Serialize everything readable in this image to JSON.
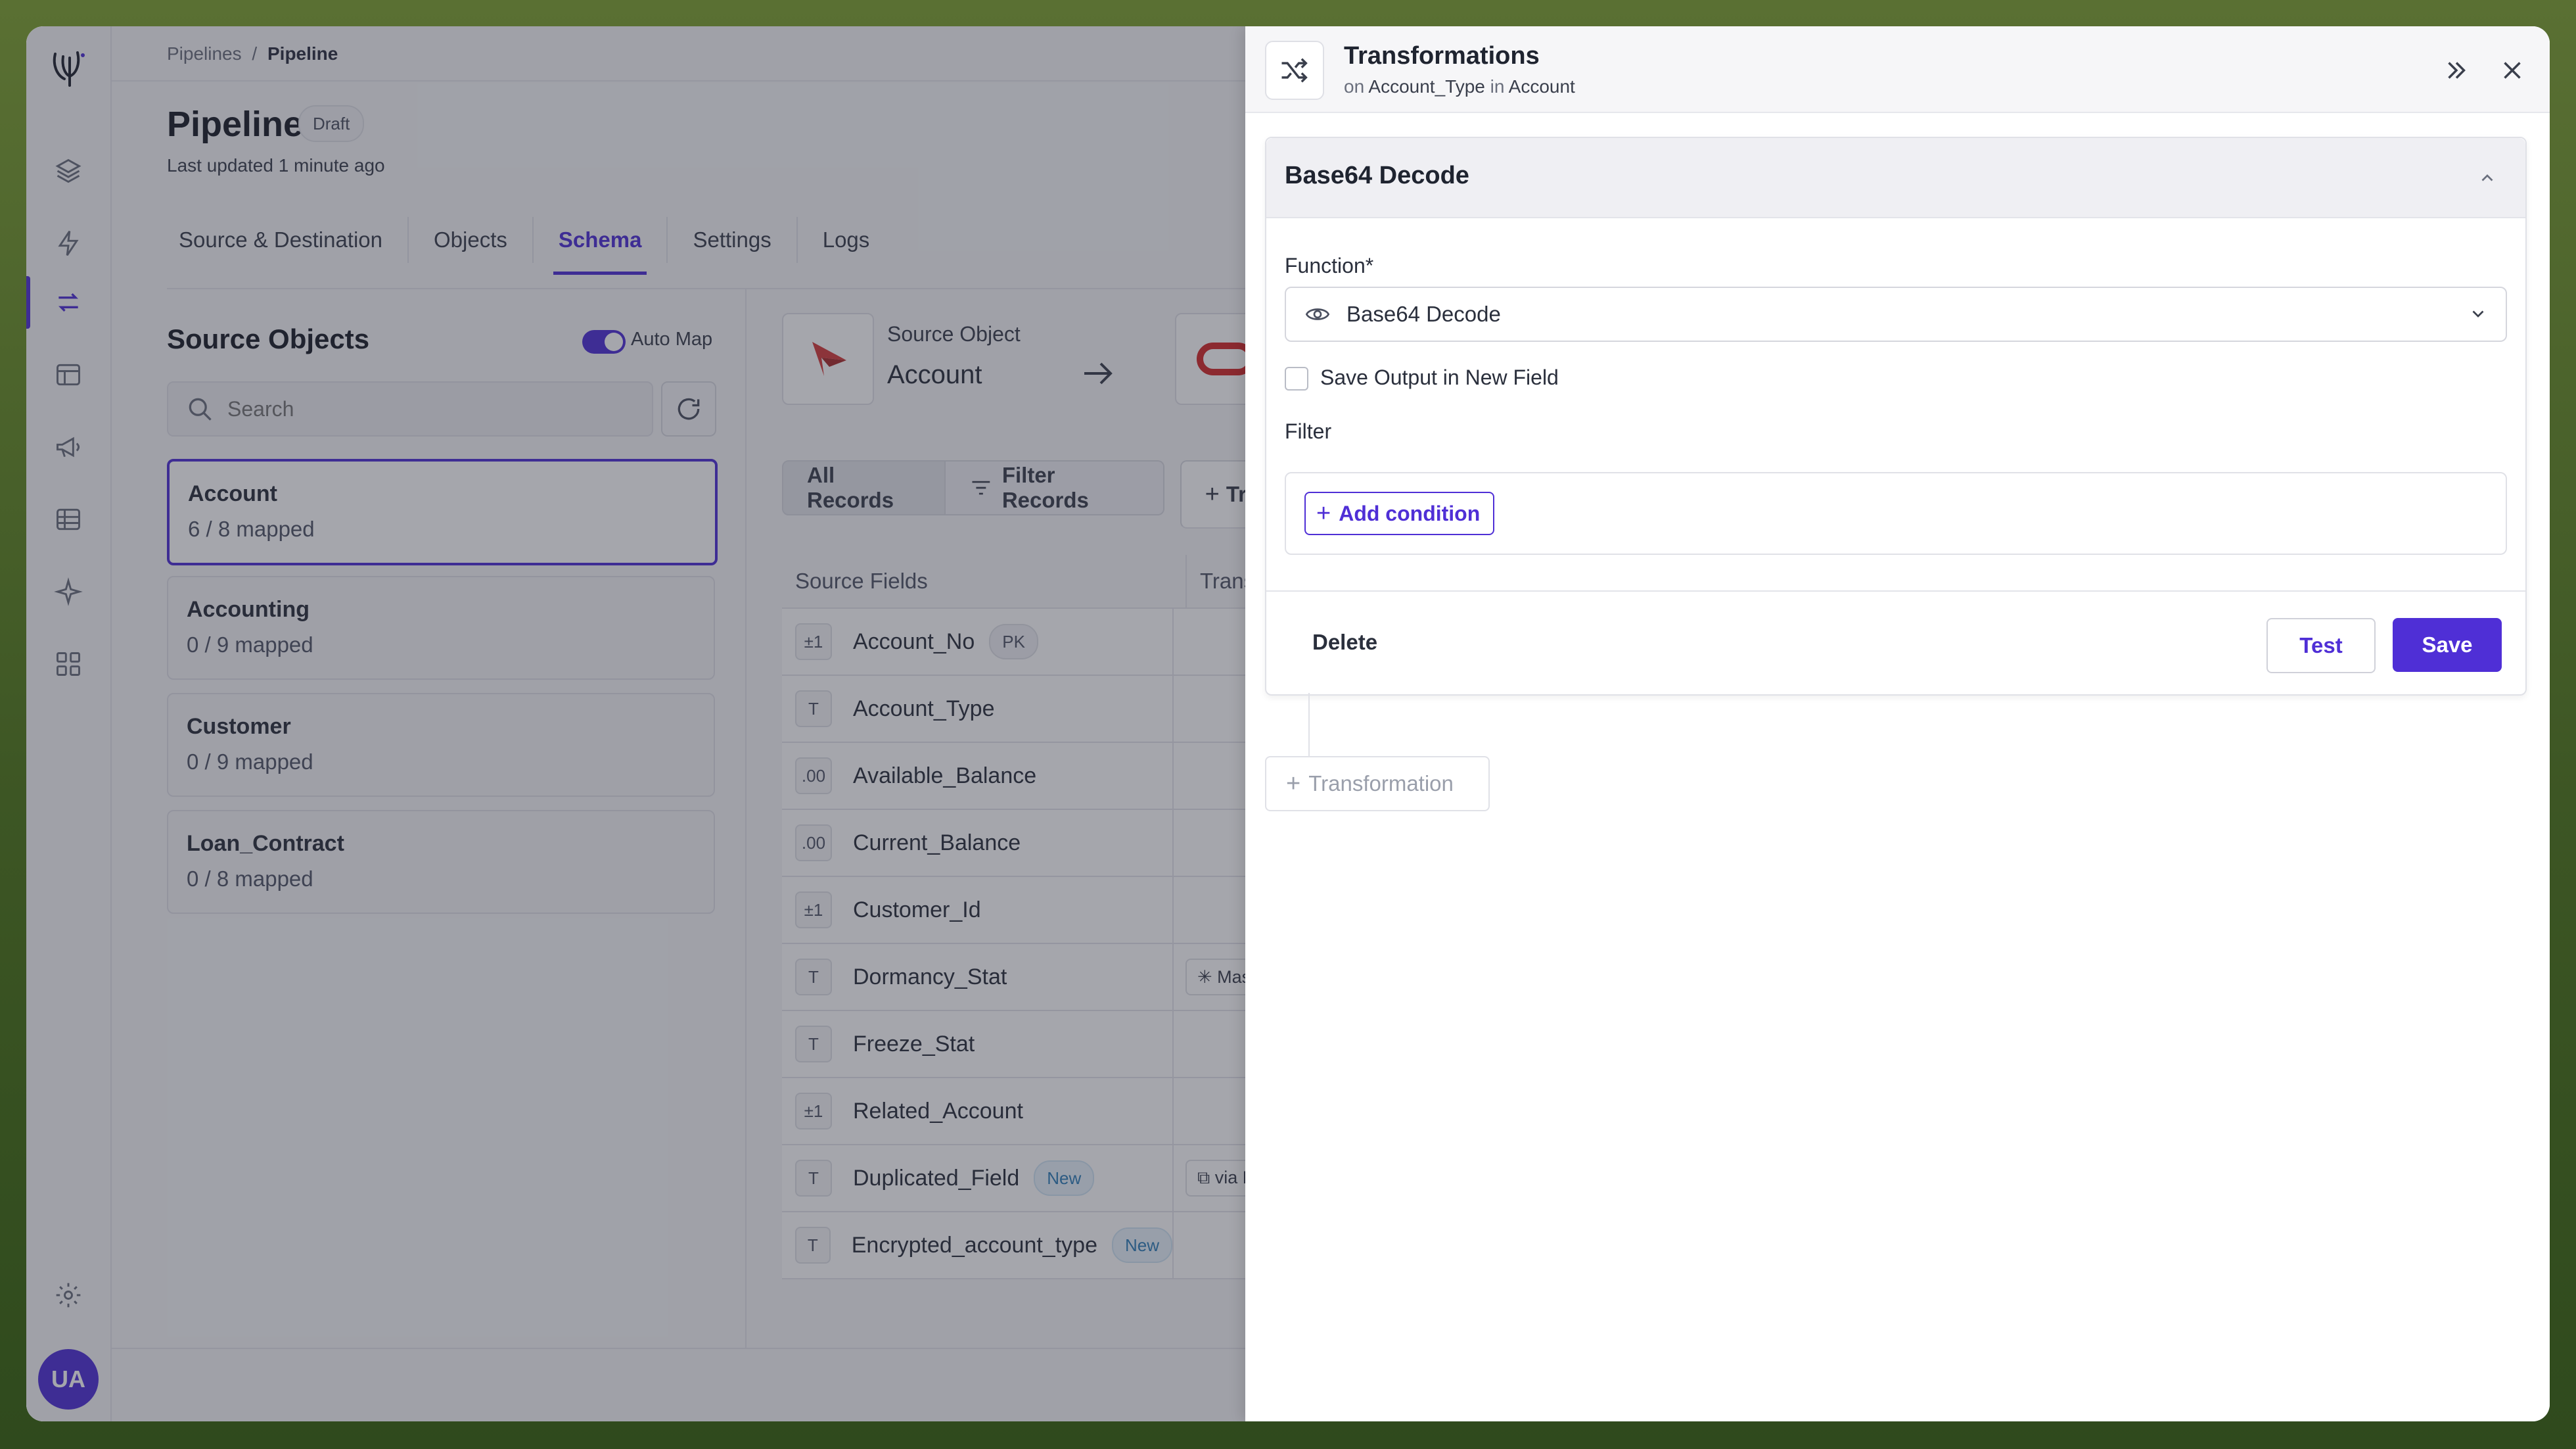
{
  "breadcrumb": {
    "parent": "Pipelines",
    "sep": "/",
    "current": "Pipeline"
  },
  "header": {
    "title": "Pipeline",
    "status": "Draft",
    "updated": "Last updated 1 minute ago"
  },
  "tabs": [
    {
      "label": "Source & Destination"
    },
    {
      "label": "Objects"
    },
    {
      "label": "Schema",
      "active": true
    },
    {
      "label": "Settings"
    },
    {
      "label": "Logs"
    }
  ],
  "source_objects": {
    "title": "Source Objects",
    "auto_map_label": "Auto Map",
    "auto_map_on": true,
    "search_placeholder": "Search",
    "items": [
      {
        "name": "Account",
        "mapped": "6 / 8 mapped",
        "selected": true
      },
      {
        "name": "Accounting",
        "mapped": "0 / 9 mapped"
      },
      {
        "name": "Customer",
        "mapped": "0 / 9 mapped"
      },
      {
        "name": "Loan_Contract",
        "mapped": "0 / 8 mapped"
      }
    ]
  },
  "mapping": {
    "source_label": "Source Object",
    "source_name": "Account",
    "buttons": {
      "all": "All Records",
      "filter": "Filter Records",
      "transform": "Tr"
    },
    "columns": {
      "source": "Source Fields",
      "transform": "Transfor"
    },
    "rows": [
      {
        "type": "±1",
        "name": "Account_No",
        "badge": "PK"
      },
      {
        "type": "T",
        "name": "Account_Type"
      },
      {
        "type": ".00",
        "name": "Available_Balance"
      },
      {
        "type": ".00",
        "name": "Current_Balance"
      },
      {
        "type": "±1",
        "name": "Customer_Id"
      },
      {
        "type": "T",
        "name": "Dormancy_Stat",
        "chip": "✳ Mask"
      },
      {
        "type": "T",
        "name": "Freeze_Stat"
      },
      {
        "type": "±1",
        "name": "Related_Account"
      },
      {
        "type": "T",
        "name": "Duplicated_Field",
        "badge": "New",
        "chip": "⧉ via Du"
      },
      {
        "type": "T",
        "name": "Encrypted_account_type",
        "badge": "New"
      }
    ]
  },
  "drawer": {
    "title": "Transformations",
    "subtitle_on": "on",
    "field": "Account_Type",
    "subtitle_in": "in",
    "object": "Account",
    "card": {
      "name": "Base64 Decode",
      "function_label": "Function*",
      "function_value": "Base64 Decode",
      "save_output_label": "Save Output in New Field",
      "save_output_checked": false,
      "filter_label": "Filter",
      "add_condition": "Add condition",
      "delete": "Delete",
      "test": "Test",
      "save": "Save"
    },
    "add_transformation": "Transformation"
  },
  "user": {
    "initials": "UA"
  },
  "colors": {
    "accent": "#4f2fd6",
    "new_badge": "#2f7fb8",
    "frame": "#4a5e2a"
  }
}
